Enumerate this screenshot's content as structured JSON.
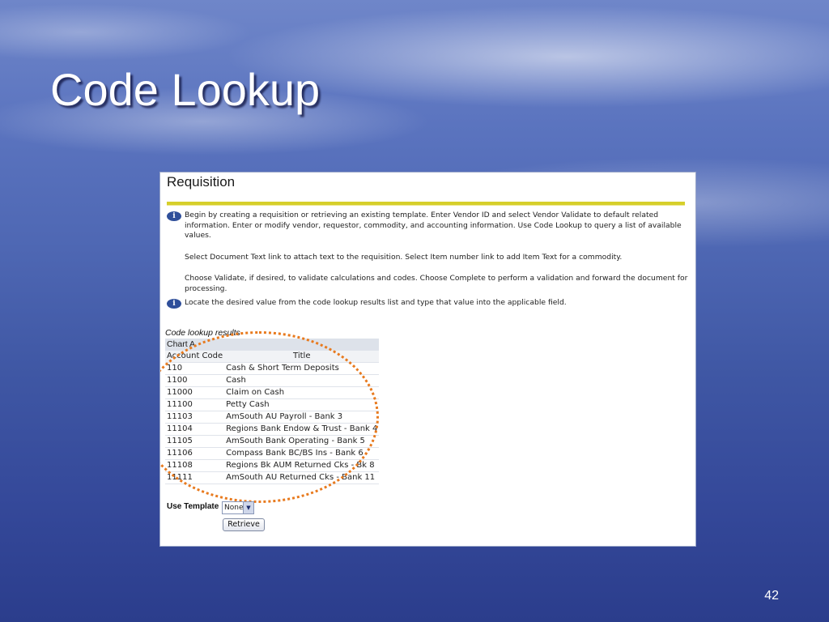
{
  "slide": {
    "title": "Code Lookup",
    "number": "42"
  },
  "colors": {
    "divider": "#d6cf2a",
    "annotation_oval": "#e87a1e",
    "info_icon": "#2f4f9a"
  },
  "screen": {
    "heading": "Requisition",
    "info1": {
      "icon": "info-icon",
      "paragraphs": [
        "Begin by creating a requisition or retrieving an existing template. Enter Vendor ID and select Vendor Validate to default related information. Enter or modify vendor, requestor, commodity, and accounting information. Use Code Lookup to query a list of available values.",
        "Select Document Text link to attach text to the requisition. Select Item number link to add Item Text for a commodity.",
        "Choose Validate, if desired, to validate calculations and codes. Choose Complete to perform a validation and forward the document for processing."
      ]
    },
    "info2": {
      "icon": "info-icon",
      "text": "Locate the desired value from the code lookup results list and type that value into the applicable field."
    },
    "results": {
      "caption": "Code lookup results",
      "chart": "Chart A",
      "headers": [
        "Account Code",
        "Title"
      ],
      "rows": [
        [
          "110",
          "Cash & Short Term Deposits"
        ],
        [
          "1100",
          "Cash"
        ],
        [
          "11000",
          "Claim on Cash"
        ],
        [
          "11100",
          "Petty Cash"
        ],
        [
          "11103",
          "AmSouth AU Payroll - Bank 3"
        ],
        [
          "11104",
          "Regions Bank Endow & Trust - Bank 4"
        ],
        [
          "11105",
          "AmSouth Bank Operating - Bank 5"
        ],
        [
          "11106",
          "Compass Bank BC/BS Ins - Bank 6"
        ],
        [
          "11108",
          "Regions Bk AUM Returned Cks - Bk 8"
        ],
        [
          "11111",
          "AmSouth AU Returned Cks - Bank 11"
        ]
      ]
    },
    "template": {
      "label": "Use Template",
      "selected": "None",
      "retrieve_label": "Retrieve"
    }
  }
}
